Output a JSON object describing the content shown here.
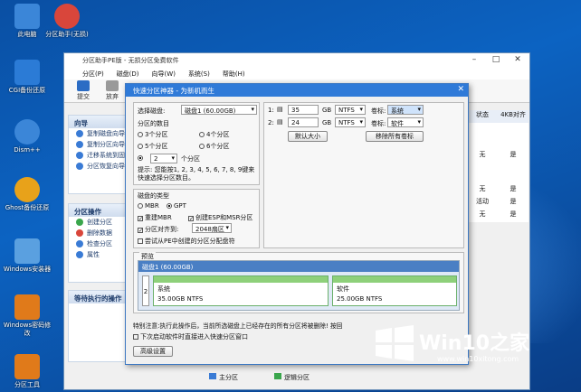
{
  "desktop": {
    "icons": [
      {
        "label": "此电脑",
        "color": "#3b86d8"
      },
      {
        "label": "分区助手(无损)",
        "color": "#d9463b"
      },
      {
        "label": "CGI备份还原",
        "color": "#2b7bd6"
      },
      {
        "label": "Dism++",
        "color": "#3b86d8"
      },
      {
        "label": "Ghost备份还原",
        "color": "#e8a21a"
      },
      {
        "label": "Windows安装器",
        "color": "#5aa0e0"
      },
      {
        "label": "Windows密码修改",
        "color": "#e07a1a"
      },
      {
        "label": "分区工具",
        "color": "#e07a1a"
      }
    ]
  },
  "app": {
    "title": "分区助手PE版 - 无损分区免费软件",
    "menus": [
      "分区(P)",
      "磁盘(D)",
      "向导(W)",
      "系统(S)",
      "帮助(H)"
    ],
    "tools": [
      "提交",
      "放弃"
    ],
    "wizard": {
      "head": "向导",
      "items": [
        "复制磁盘向导",
        "复制分区向导",
        "迁移系统到固态",
        "分区恢复向导"
      ]
    },
    "ops": {
      "head": "分区操作",
      "items": [
        "创建分区",
        "删除数据",
        "检查分区",
        "属性"
      ]
    },
    "pending": {
      "head": "等待执行的操作"
    },
    "columns": [
      "状态",
      "4KB对齐"
    ],
    "rows": [
      [
        "无",
        "是"
      ],
      [
        "无",
        "是"
      ],
      [
        "活动",
        "是"
      ],
      [
        "无",
        "是"
      ]
    ],
    "legend": [
      "主分区",
      "逻辑分区"
    ]
  },
  "dialog": {
    "title": "快速分区神器 - 为新机而生",
    "select_disk_label": "选择磁盘:",
    "select_disk_value": "磁盘1 (60.00GB)",
    "count_label": "分区的数目",
    "options": [
      "3个分区",
      "4个分区",
      "5个分区",
      "6个分区"
    ],
    "custom_value": "2",
    "custom_unit": "个分区",
    "tip": "提示: 您能按1, 2, 3, 4, 5, 6, 7, 8, 9键来快速选择分区数目。",
    "type_label": "磁盘的类型",
    "mbr": "MBR",
    "gpt": "GPT",
    "rebuild_mbr": "重建MBR",
    "create_esp": "创建ESP和MSR分区",
    "align_label": "分区对齐到:",
    "align_value": "2048扇区",
    "try_pe": "尝试从PE中创建的分区分配盘符",
    "parts": [
      {
        "num": "1:",
        "size": "35",
        "unit": "GB",
        "fs": "NTFS",
        "label_key": "卷标:",
        "label_val": "系统"
      },
      {
        "num": "2:",
        "size": "24",
        "unit": "GB",
        "fs": "NTFS",
        "label_key": "卷标:",
        "label_val": "软件"
      }
    ],
    "default_size": "默认大小",
    "clear_labels": "移除所有卷标",
    "preview_label": "预览",
    "preview_disk": "磁盘1 (60.00GB)",
    "p1_name": "系统",
    "p1_info": "35.00GB NTFS",
    "p2_name": "软件",
    "p2_info": "25.00GB NTFS",
    "note": "特别注意:执行此操作后，当前所选磁盘上已经存在的所有分区将被删除! 按回",
    "next_boot": "下次启动软件时直接进入快速分区窗口",
    "adv_btn": "高级设置"
  },
  "watermark": {
    "brand": "Win10之家",
    "url": "www.win10xitong.com"
  }
}
